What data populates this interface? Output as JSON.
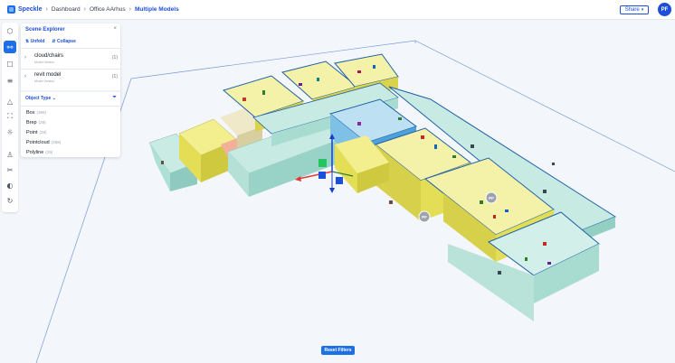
{
  "app": {
    "name": "Speckle"
  },
  "breadcrumb": [
    "Dashboard",
    "Office AArhus",
    "Multiple Models"
  ],
  "header": {
    "share_label": "Share",
    "user_initials": "PF"
  },
  "colors": {
    "accent": "#1d6fe8",
    "wall_yellow": "#e6e25a",
    "wall_teal": "#a7d9cf",
    "wall_blue": "#4ea1d8"
  },
  "rail": [
    "cube-icon",
    "scene-explorer-icon",
    "comment-icon",
    "layers-icon",
    "measure-icon",
    "fullscreen-icon",
    "light-icon",
    "users-icon",
    "section-icon",
    "palette-icon",
    "refresh-icon"
  ],
  "scene_explorer": {
    "title": "Scene Explorer",
    "unfold_label": "Unfold",
    "collapse_label": "Collapse",
    "models": [
      {
        "name": "cloud/chairs",
        "subtitle": "Model Version",
        "count": "(1)"
      },
      {
        "name": "revit model",
        "subtitle": "Model Version",
        "count": "(1)"
      }
    ],
    "filter_label": "Object Type",
    "filters": [
      {
        "name": "Box",
        "count": "(389)"
      },
      {
        "name": "Brep",
        "count": "(29)"
      },
      {
        "name": "Point",
        "count": "(29)"
      },
      {
        "name": "Pointcloud",
        "count": "(389)"
      },
      {
        "name": "Polyline",
        "count": "(29)"
      }
    ]
  },
  "scene": {
    "markers": [
      "PF",
      "PF"
    ]
  },
  "reset_label": "Reset Filters"
}
